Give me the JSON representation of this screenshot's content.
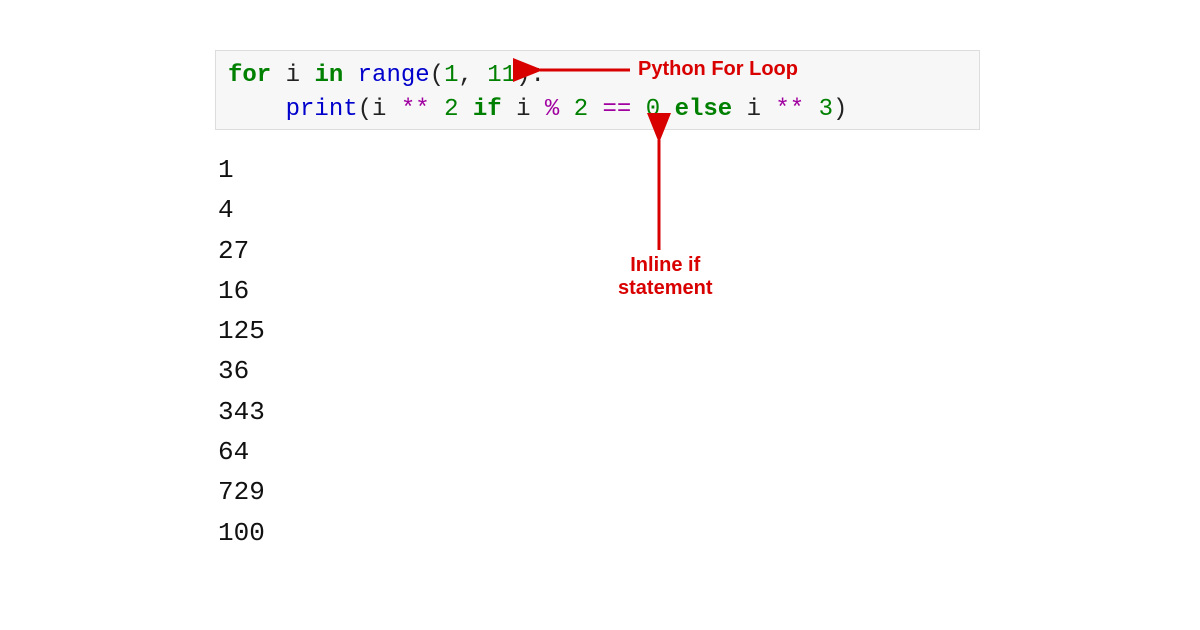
{
  "code": {
    "line1": {
      "for": "for",
      "sp1": " ",
      "var": "i",
      "sp2": " ",
      "in": "in",
      "sp3": " ",
      "range": "range",
      "lparen": "(",
      "arg1": "1",
      "comma": ", ",
      "arg2": "11",
      "rparen": ")",
      "colon": ":"
    },
    "line2": {
      "indent": "    ",
      "print": "print",
      "lparen": "(",
      "var1": "i",
      "sp1": " ",
      "pow1": "**",
      "sp2": " ",
      "two": "2",
      "sp3": " ",
      "if": "if",
      "sp4": " ",
      "var2": "i",
      "sp5": " ",
      "mod": "%",
      "sp6": " ",
      "two_b": "2",
      "sp7": " ",
      "eq": "==",
      "sp8": " ",
      "zero": "0",
      "sp9": " ",
      "else": "else",
      "sp10": " ",
      "var3": "i",
      "sp11": " ",
      "pow2": "**",
      "sp12": " ",
      "three": "3",
      "rparen": ")"
    }
  },
  "output": [
    "1",
    "4",
    "27",
    "16",
    "125",
    "36",
    "343",
    "64",
    "729",
    "100"
  ],
  "annotations": {
    "loop_label": "Python For Loop",
    "inline_label_l1": "Inline if",
    "inline_label_l2": "statement"
  },
  "colors": {
    "annotation": "#d90000",
    "code_bg": "#f7f7f7"
  }
}
